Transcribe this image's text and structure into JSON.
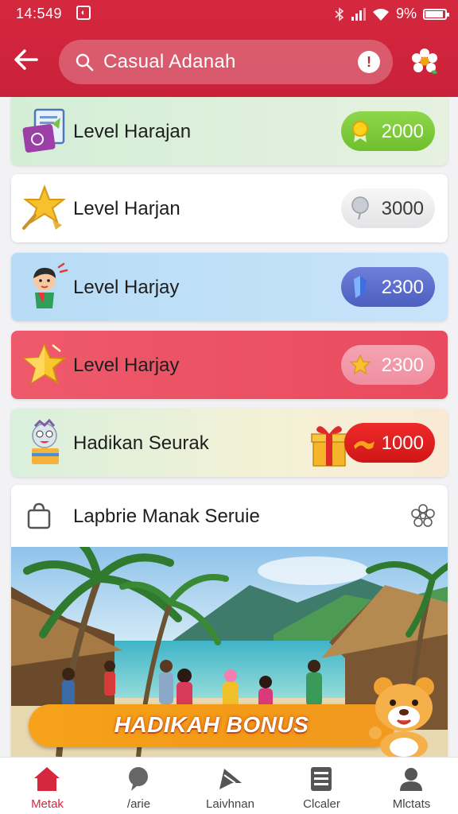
{
  "status_bar": {
    "time": "14:549",
    "battery": "9%"
  },
  "header": {
    "search_text": "Casual Adanah"
  },
  "levels": [
    {
      "label": "Level Harajan",
      "value": "2000",
      "icon": "document-icon",
      "badge_icon": "gold-medal-icon"
    },
    {
      "label": "Level Harjan",
      "value": "3000",
      "icon": "star-wand-icon",
      "badge_icon": "silver-balloon-icon"
    },
    {
      "label": "Level Harjay",
      "value": "2300",
      "icon": "character-icon",
      "badge_icon": "blue-gem-icon"
    },
    {
      "label": "Level Harjay",
      "value": "2300",
      "icon": "gold-star-icon",
      "badge_icon": "star-icon"
    },
    {
      "label": "Hadikan Seurak",
      "value": "1000",
      "icon": "mascot-icon",
      "badge_icon": "ticket-icon"
    }
  ],
  "bonus": {
    "title": "Lapbrie Manak Seruie",
    "banner": "HADIKAH BONUS"
  },
  "nav": [
    {
      "label": "Metak",
      "icon": "home-icon",
      "active": true
    },
    {
      "label": "/arie",
      "icon": "chat-icon",
      "active": false
    },
    {
      "label": "Laivhnan",
      "icon": "pointer-icon",
      "active": false
    },
    {
      "label": "Clcaler",
      "icon": "list-icon",
      "active": false
    },
    {
      "label": "Mlctats",
      "icon": "profile-icon",
      "active": false
    }
  ],
  "colors": {
    "primary": "#d5283e",
    "green_pill": "#7ccb3a",
    "blue_pill": "#5a6cd0",
    "red_pill": "#e21f1f",
    "banner": "#f6a21a"
  }
}
